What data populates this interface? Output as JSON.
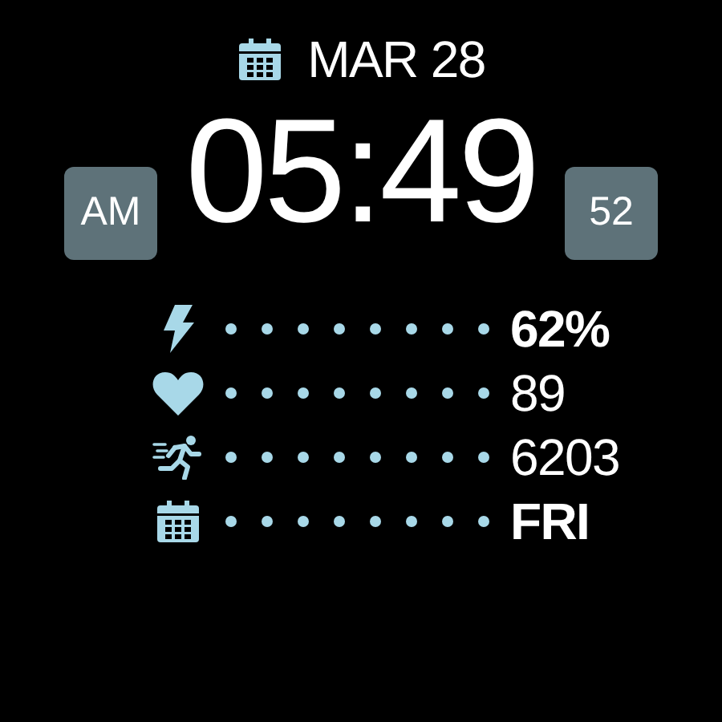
{
  "date": "MAR 28",
  "time": "05:49",
  "meridiem": "AM",
  "seconds": "52",
  "stats": [
    {
      "kind": "battery",
      "value": "62%",
      "bold": true
    },
    {
      "kind": "heart",
      "value": "89",
      "bold": false
    },
    {
      "kind": "steps",
      "value": "6203",
      "bold": false
    },
    {
      "kind": "calendar",
      "value": "FRI",
      "bold": true
    }
  ]
}
